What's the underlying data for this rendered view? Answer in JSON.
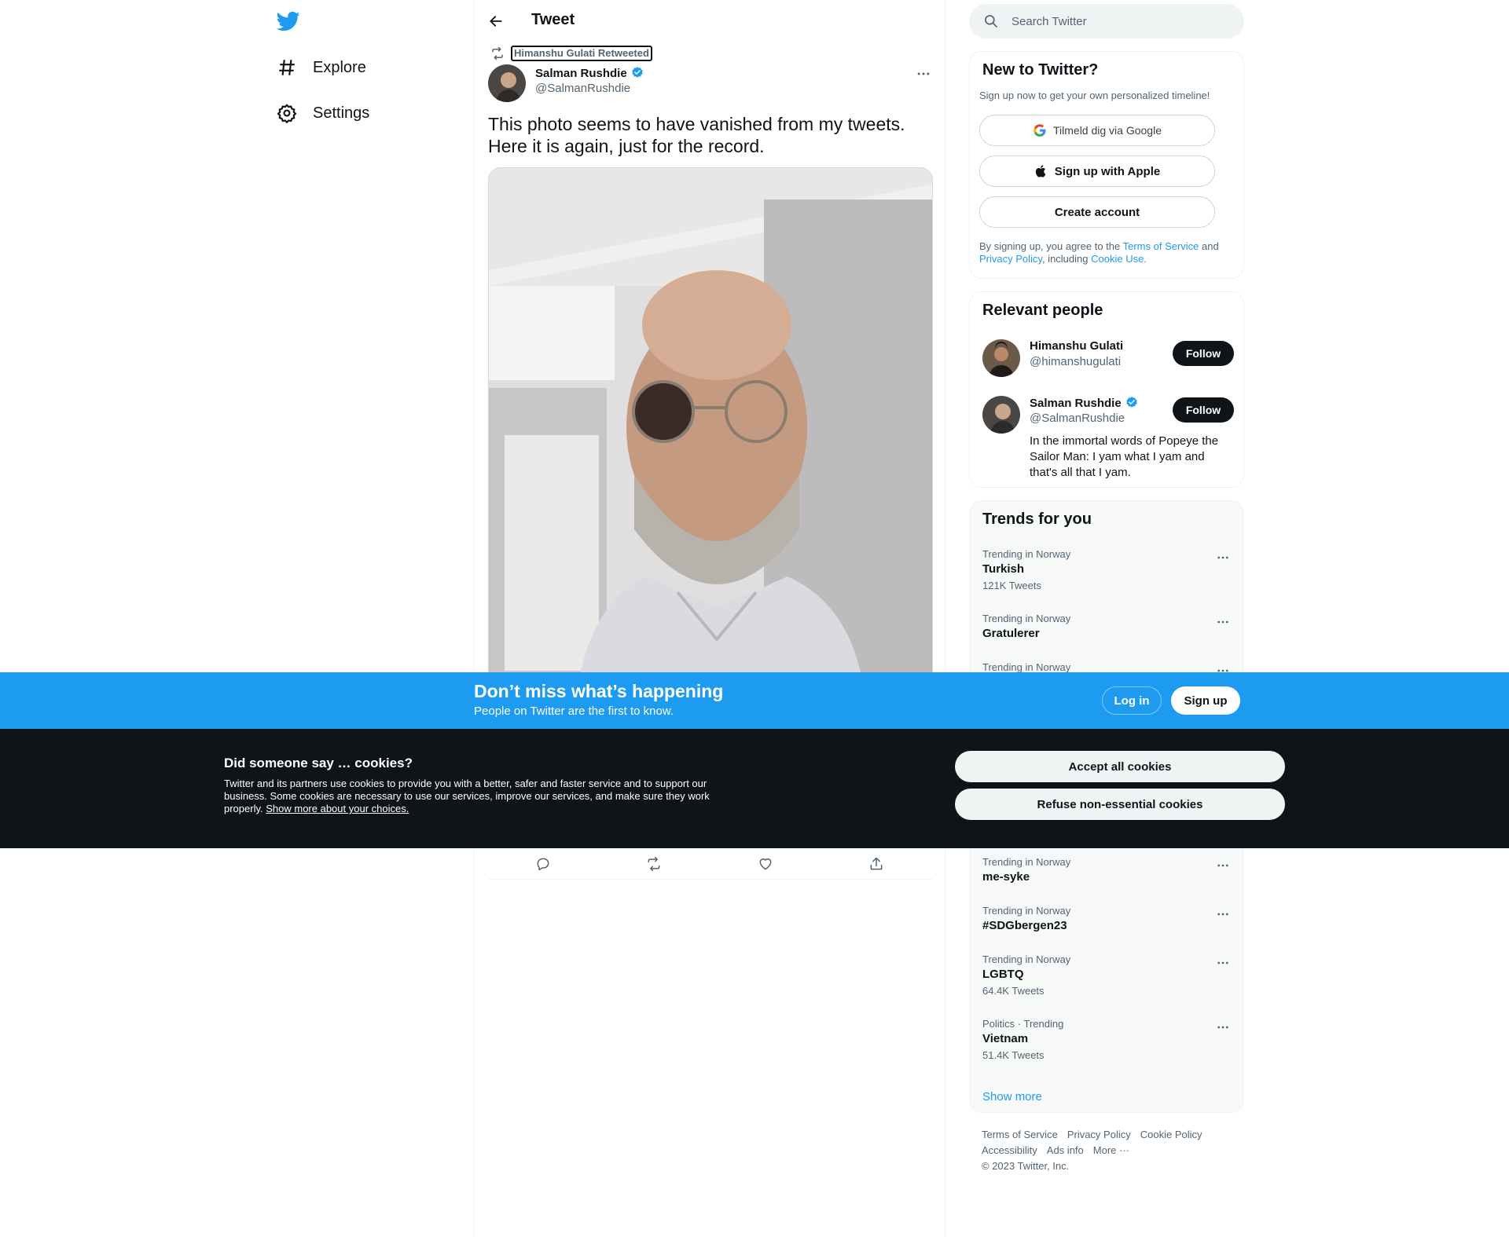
{
  "nav": {
    "explore_label": "Explore",
    "settings_label": "Settings"
  },
  "header": {
    "title": "Tweet"
  },
  "tweet": {
    "retweeted_by": "Himanshu Gulati Retweeted",
    "author_name": "Salman Rushdie",
    "author_handle": "@SalmanRushdie",
    "text": "This photo seems to have vanished from my tweets. Here it is again, just for the record."
  },
  "search": {
    "placeholder": "Search Twitter"
  },
  "signup": {
    "title": "New to Twitter?",
    "subtitle": "Sign up now to get your own personalized timeline!",
    "google_label": "Tilmeld dig via Google",
    "apple_label": "Sign up with Apple",
    "create_label": "Create account",
    "legal_prefix": "By signing up, you agree to the ",
    "terms_link": "Terms of Service",
    "legal_and": " and ",
    "privacy_link": "Privacy Policy",
    "legal_including": ", including ",
    "cookie_link": "Cookie Use."
  },
  "people": {
    "title": "Relevant people",
    "items": [
      {
        "name": "Himanshu Gulati",
        "handle": "@himanshugulati",
        "follow": "Follow",
        "bio": ""
      },
      {
        "name": "Salman Rushdie",
        "handle": "@SalmanRushdie",
        "follow": "Follow",
        "bio": "In the immortal words of Popeye the Sailor Man: I yam what I yam and that's all that I yam."
      }
    ]
  },
  "trends": {
    "title": "Trends for you",
    "items": [
      {
        "context": "Trending in Norway",
        "name": "Turkish",
        "count": "121K Tweets"
      },
      {
        "context": "Trending in Norway",
        "name": "Gratulerer",
        "count": ""
      },
      {
        "context": "Trending in Norway",
        "name": "",
        "count": ""
      },
      {
        "context": "Trending in Norway",
        "name": "me-syke",
        "count": ""
      },
      {
        "context": "Trending in Norway",
        "name": "#SDGbergen23",
        "count": ""
      },
      {
        "context": "Trending in Norway",
        "name": "LGBTQ",
        "count": "64.4K Tweets"
      },
      {
        "context": "Politics · Trending",
        "name": "Vietnam",
        "count": "51.4K Tweets"
      }
    ],
    "show_more": "Show more"
  },
  "footer": {
    "terms": "Terms of Service",
    "privacy": "Privacy Policy",
    "cookie": "Cookie Policy",
    "accessibility": "Accessibility",
    "ads": "Ads info",
    "more": "More ···",
    "copyright": "© 2023 Twitter, Inc."
  },
  "banner": {
    "title": "Don’t miss what’s happening",
    "subtitle": "People on Twitter are the first to know.",
    "login": "Log in",
    "signup": "Sign up"
  },
  "cookies": {
    "title": "Did someone say … cookies?",
    "body": "Twitter and its partners use cookies to provide you with a better, safer and faster service and to support our business. Some cookies are necessary to use our services, improve our services, and make sure they work properly. ",
    "link": "Show more about your choices.",
    "accept": "Accept all cookies",
    "refuse": "Refuse non-essential cookies"
  },
  "colors": {
    "brand": "#1d9bf0",
    "dark": "#0f1419",
    "muted": "#536471"
  }
}
